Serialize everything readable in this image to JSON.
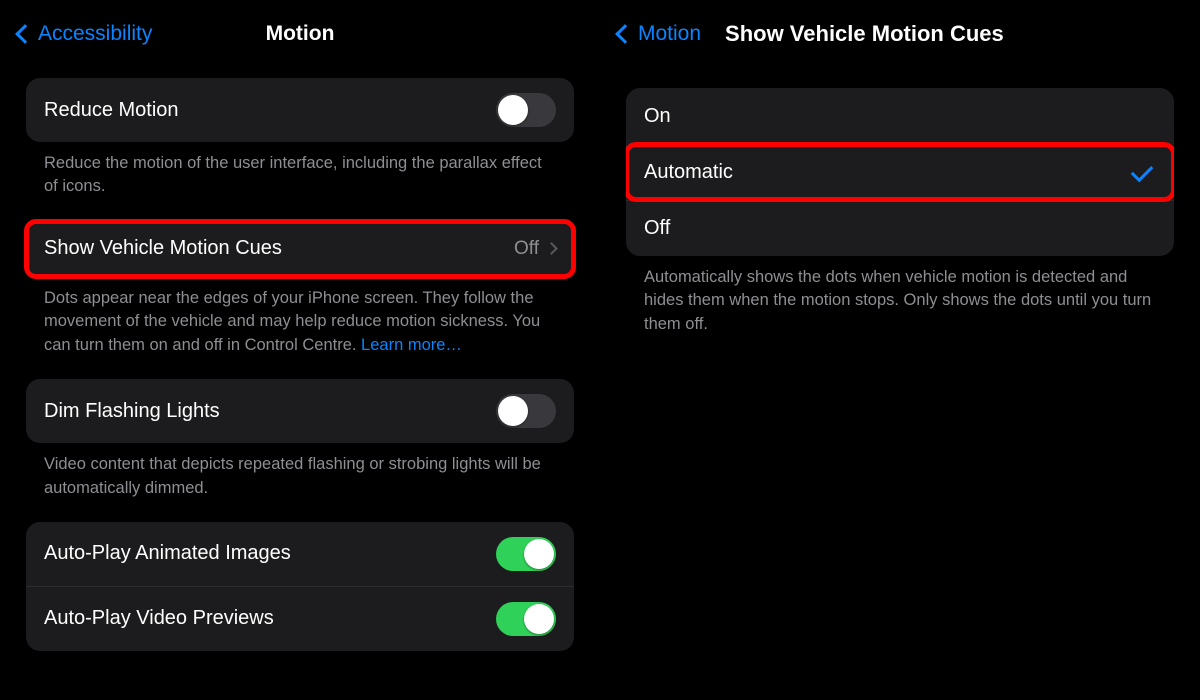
{
  "left": {
    "back_label": "Accessibility",
    "title": "Motion",
    "reduce_motion": {
      "label": "Reduce Motion",
      "on": false
    },
    "reduce_motion_footer": "Reduce the motion of the user interface, including the parallax effect of icons.",
    "vehicle_cues": {
      "label": "Show Vehicle Motion Cues",
      "value": "Off"
    },
    "vehicle_cues_footer_text": "Dots appear near the edges of your iPhone screen. They follow the movement of the vehicle and may help reduce motion sickness. You can turn them on and off in Control Centre. ",
    "vehicle_cues_learn_more": "Learn more…",
    "dim_flashing": {
      "label": "Dim Flashing Lights",
      "on": false
    },
    "dim_flashing_footer": "Video content that depicts repeated flashing or strobing lights will be automatically dimmed.",
    "autoplay_images": {
      "label": "Auto-Play Animated Images",
      "on": true
    },
    "autoplay_previews": {
      "label": "Auto-Play Video Previews",
      "on": true
    }
  },
  "right": {
    "back_label": "Motion",
    "title": "Show Vehicle Motion Cues",
    "options": {
      "on": "On",
      "automatic": "Automatic",
      "off": "Off"
    },
    "selected": "automatic",
    "footer": "Automatically shows the dots when vehicle motion is detected and hides them when the motion stops. Only shows the dots until you turn them off."
  }
}
